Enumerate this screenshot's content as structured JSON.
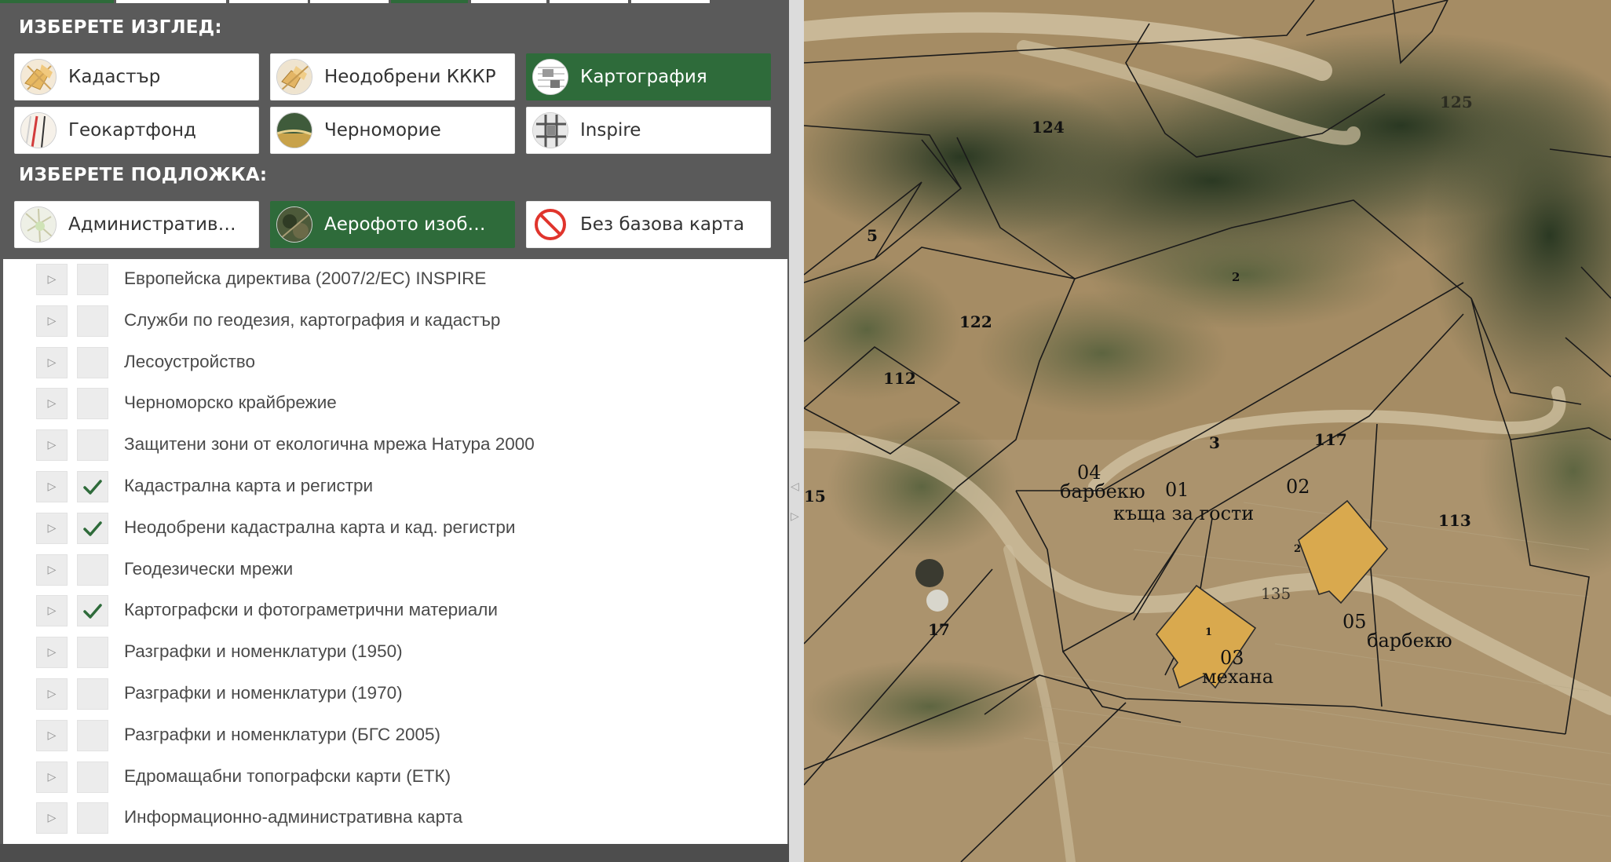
{
  "view_section": {
    "title": "ИЗБЕРЕТЕ ИЗГЛЕД:",
    "options": [
      {
        "label": "Кадастър",
        "icon": "cadastre-map-icon",
        "active": false
      },
      {
        "label": "Неодобрени КККР",
        "icon": "unapproved-cadastre-icon",
        "active": false
      },
      {
        "label": "Картография",
        "icon": "cartography-icon",
        "active": true
      },
      {
        "label": "Геокартфонд",
        "icon": "geocartfond-icon",
        "active": false
      },
      {
        "label": "Черноморие",
        "icon": "black-sea-coast-icon",
        "active": false
      },
      {
        "label": "Inspire",
        "icon": "inspire-icon",
        "active": false
      }
    ]
  },
  "base_section": {
    "title": "ИЗБЕРЕТЕ ПОДЛОЖКА:",
    "options": [
      {
        "label": "Административна карта",
        "icon": "administrative-map-icon",
        "active": false
      },
      {
        "label": "Аерофото изображение",
        "icon": "aerial-photo-icon",
        "active": true
      },
      {
        "label": "Без базова карта",
        "icon": "no-base-map-icon",
        "active": false
      }
    ]
  },
  "layers": [
    {
      "label": "Европейска директива (2007/2/ЕС) INSPIRE",
      "checked": false
    },
    {
      "label": "Служби по геодезия, картография и кадастър",
      "checked": false
    },
    {
      "label": "Лесоустройство",
      "checked": false
    },
    {
      "label": "Черноморско крайбрежие",
      "checked": false
    },
    {
      "label": "Защитени зони от екологична мрежа Натура 2000",
      "checked": false
    },
    {
      "label": "Кадастрална карта и регистри",
      "checked": true
    },
    {
      "label": "Неодобрени кадастрална карта и кад. регистри",
      "checked": true
    },
    {
      "label": "Геодезически мрежи",
      "checked": false
    },
    {
      "label": "Картографски и фотограметрични материали",
      "checked": true
    },
    {
      "label": "Разграфки и номенклатури (1950)",
      "checked": false
    },
    {
      "label": "Разграфки и номенклатури (1970)",
      "checked": false
    },
    {
      "label": "Разграфки и номенклатури (БГС 2005)",
      "checked": false
    },
    {
      "label": "Едромащабни топографски карти (ЕТК)",
      "checked": false
    },
    {
      "label": "Информационно-административна карта",
      "checked": false
    }
  ],
  "map": {
    "parcel_labels": [
      "124",
      "125",
      "5",
      "2",
      "122",
      "112",
      "3",
      "117",
      "15",
      "113",
      "17",
      "135",
      "1",
      "2"
    ],
    "building_labels": [
      "04",
      "барбекю",
      "01",
      "къща за гости",
      "02",
      "05",
      "барбекю",
      "03",
      "механа"
    ]
  },
  "colors": {
    "accent": "#2e6b3a",
    "panel_bg": "#5a5a5a",
    "building_fill": "#d9a94e"
  }
}
